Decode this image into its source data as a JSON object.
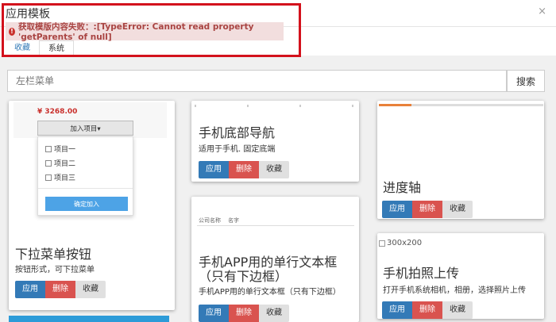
{
  "dialog": {
    "title": "应用模板",
    "close_symbol": "×",
    "error_icon": "!",
    "error_message": "获取模版内容失败：:[TypeError: Cannot read property 'getParents' of null]"
  },
  "tabs": [
    {
      "label": "收藏",
      "active": false
    },
    {
      "label": "系统",
      "active": true
    }
  ],
  "search": {
    "placeholder": "左栏菜单",
    "button_label": "搜索"
  },
  "buttons": {
    "apply": "应用",
    "delete": "删除",
    "favorite": "收藏"
  },
  "cards": {
    "dropdown": {
      "price": "¥ 3268.00",
      "dropdown_label": "加入项目▾",
      "items": [
        "项目一",
        "项目二",
        "项目三"
      ],
      "confirm_label": "确定加入",
      "title": "下拉菜单按钮",
      "description": "按钮形式，可下拉菜单"
    },
    "bottom_nav": {
      "title": "手机底部导航",
      "description": "适用于手机. 固定底端"
    },
    "single_text": {
      "field_labels": [
        "公司名称",
        "名字"
      ],
      "title_line1": "手机APP用的单行文本框",
      "title_line2": "（只有下边框）",
      "description": "手机APP用的单行文本框（只有下边框）"
    },
    "progress": {
      "title": "进度轴",
      "progress_fraction": 0.2
    },
    "photo_upload": {
      "image_alt": "300x200",
      "title": "手机拍照上传",
      "description": "打开手机系统相机，相册，选择照片上传"
    }
  },
  "colors": {
    "highlight_border": "#d3111c",
    "alert_bg": "#f2dede",
    "alert_text": "#a94442",
    "primary": "#337ab7",
    "danger": "#d9534f",
    "progress": "#e8813a"
  }
}
